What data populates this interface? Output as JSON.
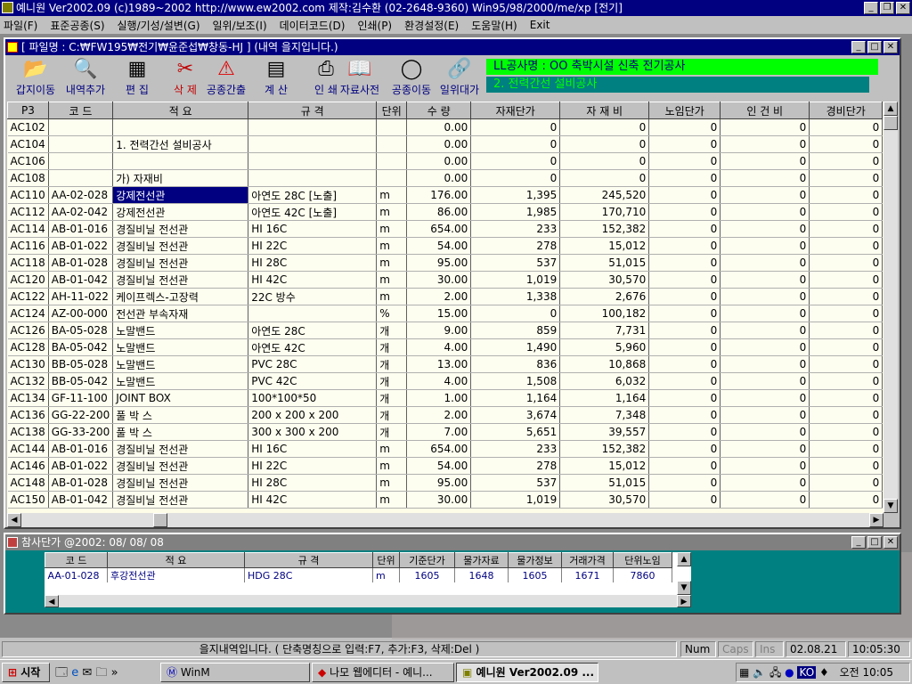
{
  "app": {
    "title": "예니원 Ver2002.09 (c)1989~2002 http://www.ew2002.com 제작:김수환 (02-2648-9360) Win95/98/2000/me/xp [전기]",
    "menu": [
      "파일(F)",
      "표준공종(S)",
      "실행/기성/설변(G)",
      "일위/보조(I)",
      "데이터코드(D)",
      "인쇄(P)",
      "환경설정(E)",
      "도움말(H)",
      "Exit"
    ]
  },
  "mainWindow": {
    "title": "[ 파일명 : C:₩FW195₩전기₩윤준섭₩창동-HJ ] (내역 을지입니다.)",
    "toolbar": [
      {
        "label": "갑지이동",
        "icon": "folder-open-icon",
        "glyph": "📂"
      },
      {
        "label": "내역추가",
        "icon": "magnifier-icon",
        "glyph": "🔍"
      },
      {
        "label": "편 집",
        "icon": "edit-grid-icon",
        "glyph": "▦"
      },
      {
        "label": "삭 제",
        "icon": "scissors-icon",
        "glyph": "✂"
      },
      {
        "label": "공종간출",
        "icon": "warning-sign-icon",
        "glyph": "⚠"
      },
      {
        "label": "계 산",
        "icon": "calculator-icon",
        "glyph": "▤"
      },
      {
        "label": "인 쇄",
        "icon": "printer-icon",
        "glyph": "⎙"
      },
      {
        "label": "자료사전",
        "icon": "book-icon",
        "glyph": "📖"
      },
      {
        "label": "공종이동",
        "icon": "ring-icon",
        "glyph": "◯"
      },
      {
        "label": "일위대가",
        "icon": "link-icon",
        "glyph": "🔗"
      }
    ],
    "project1": "LL공사명 : OO 축박시설 신축 전기공사",
    "project2": "2. 전력간선 설비공사",
    "columns": [
      "P3",
      "코 드",
      "적 요",
      "규 격",
      "단위",
      "수 량",
      "자재단가",
      "자 재 비",
      "노임단가",
      "인 건 비",
      "경비단가"
    ],
    "rows": [
      [
        "AC102",
        "",
        "",
        "",
        "",
        "0.00",
        "0",
        "0",
        "0",
        "0",
        "0"
      ],
      [
        "AC104",
        "",
        "1. 전력간선 설비공사",
        "",
        "",
        "0.00",
        "0",
        "0",
        "0",
        "0",
        "0"
      ],
      [
        "AC106",
        "",
        "",
        "",
        "",
        "0.00",
        "0",
        "0",
        "0",
        "0",
        "0"
      ],
      [
        "AC108",
        "",
        "가) 자재비",
        "",
        "",
        "0.00",
        "0",
        "0",
        "0",
        "0",
        "0"
      ],
      [
        "AC110",
        "AA-02-028",
        "강제전선관",
        "아연도 28C [노출]",
        "m",
        "176.00",
        "1,395",
        "245,520",
        "0",
        "0",
        "0"
      ],
      [
        "AC112",
        "AA-02-042",
        "강제전선관",
        "아연도 42C [노출]",
        "m",
        "86.00",
        "1,985",
        "170,710",
        "0",
        "0",
        "0"
      ],
      [
        "AC114",
        "AB-01-016",
        "경질비닐 전선관",
        "HI 16C",
        "m",
        "654.00",
        "233",
        "152,382",
        "0",
        "0",
        "0"
      ],
      [
        "AC116",
        "AB-01-022",
        "경질비닐 전선관",
        "HI 22C",
        "m",
        "54.00",
        "278",
        "15,012",
        "0",
        "0",
        "0"
      ],
      [
        "AC118",
        "AB-01-028",
        "경질비닐 전선관",
        "HI 28C",
        "m",
        "95.00",
        "537",
        "51,015",
        "0",
        "0",
        "0"
      ],
      [
        "AC120",
        "AB-01-042",
        "경질비닐 전선관",
        "HI 42C",
        "m",
        "30.00",
        "1,019",
        "30,570",
        "0",
        "0",
        "0"
      ],
      [
        "AC122",
        "AH-11-022",
        "케이프렉스-고장력",
        "22C 방수",
        "m",
        "2.00",
        "1,338",
        "2,676",
        "0",
        "0",
        "0"
      ],
      [
        "AC124",
        "AZ-00-000",
        "전선관 부속자재",
        "",
        "%",
        "15.00",
        "0",
        "100,182",
        "0",
        "0",
        "0"
      ],
      [
        "AC126",
        "BA-05-028",
        "노말밴드",
        "아연도 28C",
        "개",
        "9.00",
        "859",
        "7,731",
        "0",
        "0",
        "0"
      ],
      [
        "AC128",
        "BA-05-042",
        "노말밴드",
        "아연도 42C",
        "개",
        "4.00",
        "1,490",
        "5,960",
        "0",
        "0",
        "0"
      ],
      [
        "AC130",
        "BB-05-028",
        "노말밴드",
        "PVC 28C",
        "개",
        "13.00",
        "836",
        "10,868",
        "0",
        "0",
        "0"
      ],
      [
        "AC132",
        "BB-05-042",
        "노말밴드",
        "PVC 42C",
        "개",
        "4.00",
        "1,508",
        "6,032",
        "0",
        "0",
        "0"
      ],
      [
        "AC134",
        "GF-11-100",
        "JOINT BOX",
        "100*100*50",
        "개",
        "1.00",
        "1,164",
        "1,164",
        "0",
        "0",
        "0"
      ],
      [
        "AC136",
        "GG-22-200",
        "풀 박 스",
        "200 x 200 x 200",
        "개",
        "2.00",
        "3,674",
        "7,348",
        "0",
        "0",
        "0"
      ],
      [
        "AC138",
        "GG-33-200",
        "풀 박 스",
        "300 x 300 x 200",
        "개",
        "7.00",
        "5,651",
        "39,557",
        "0",
        "0",
        "0"
      ],
      [
        "AC144",
        "AB-01-016",
        "경질비닐 전선관",
        "HI 16C",
        "m",
        "654.00",
        "233",
        "152,382",
        "0",
        "0",
        "0"
      ],
      [
        "AC146",
        "AB-01-022",
        "경질비닐 전선관",
        "HI 22C",
        "m",
        "54.00",
        "278",
        "15,012",
        "0",
        "0",
        "0"
      ],
      [
        "AC148",
        "AB-01-028",
        "경질비닐 전선관",
        "HI 28C",
        "m",
        "95.00",
        "537",
        "51,015",
        "0",
        "0",
        "0"
      ],
      [
        "AC150",
        "AB-01-042",
        "경질비닐 전선관",
        "HI 42C",
        "m",
        "30.00",
        "1,019",
        "30,570",
        "0",
        "0",
        "0"
      ]
    ],
    "selectedRow": 4
  },
  "lowerWindow": {
    "title": "참사단가  @2002: 08/ 08/ 08",
    "columns": [
      "코 드",
      "적 요",
      "규 격",
      "단위",
      "기준단가",
      "물가자료",
      "물가정보",
      "거래가격",
      "단위노임"
    ],
    "row": [
      "AA-01-028",
      "후강전선관",
      "HDG 28C",
      "m",
      "1605",
      "1648",
      "1605",
      "1671",
      "7860"
    ]
  },
  "statusBar": {
    "message": "을지내역입니다. ( 단축명칭으로 입력:F7, 추가:F3, 삭제:Del )",
    "num": "Num",
    "caps": "Caps",
    "ins": "Ins",
    "date": "02.08.21",
    "time": "10:05:30"
  },
  "taskbar": {
    "start": "시작",
    "tasks": [
      "WinM",
      "나모 웹에디터 - 예니...",
      "예니원 Ver2002.09 ..."
    ],
    "clock": "오전 10:05",
    "tray_ko": "KO"
  }
}
